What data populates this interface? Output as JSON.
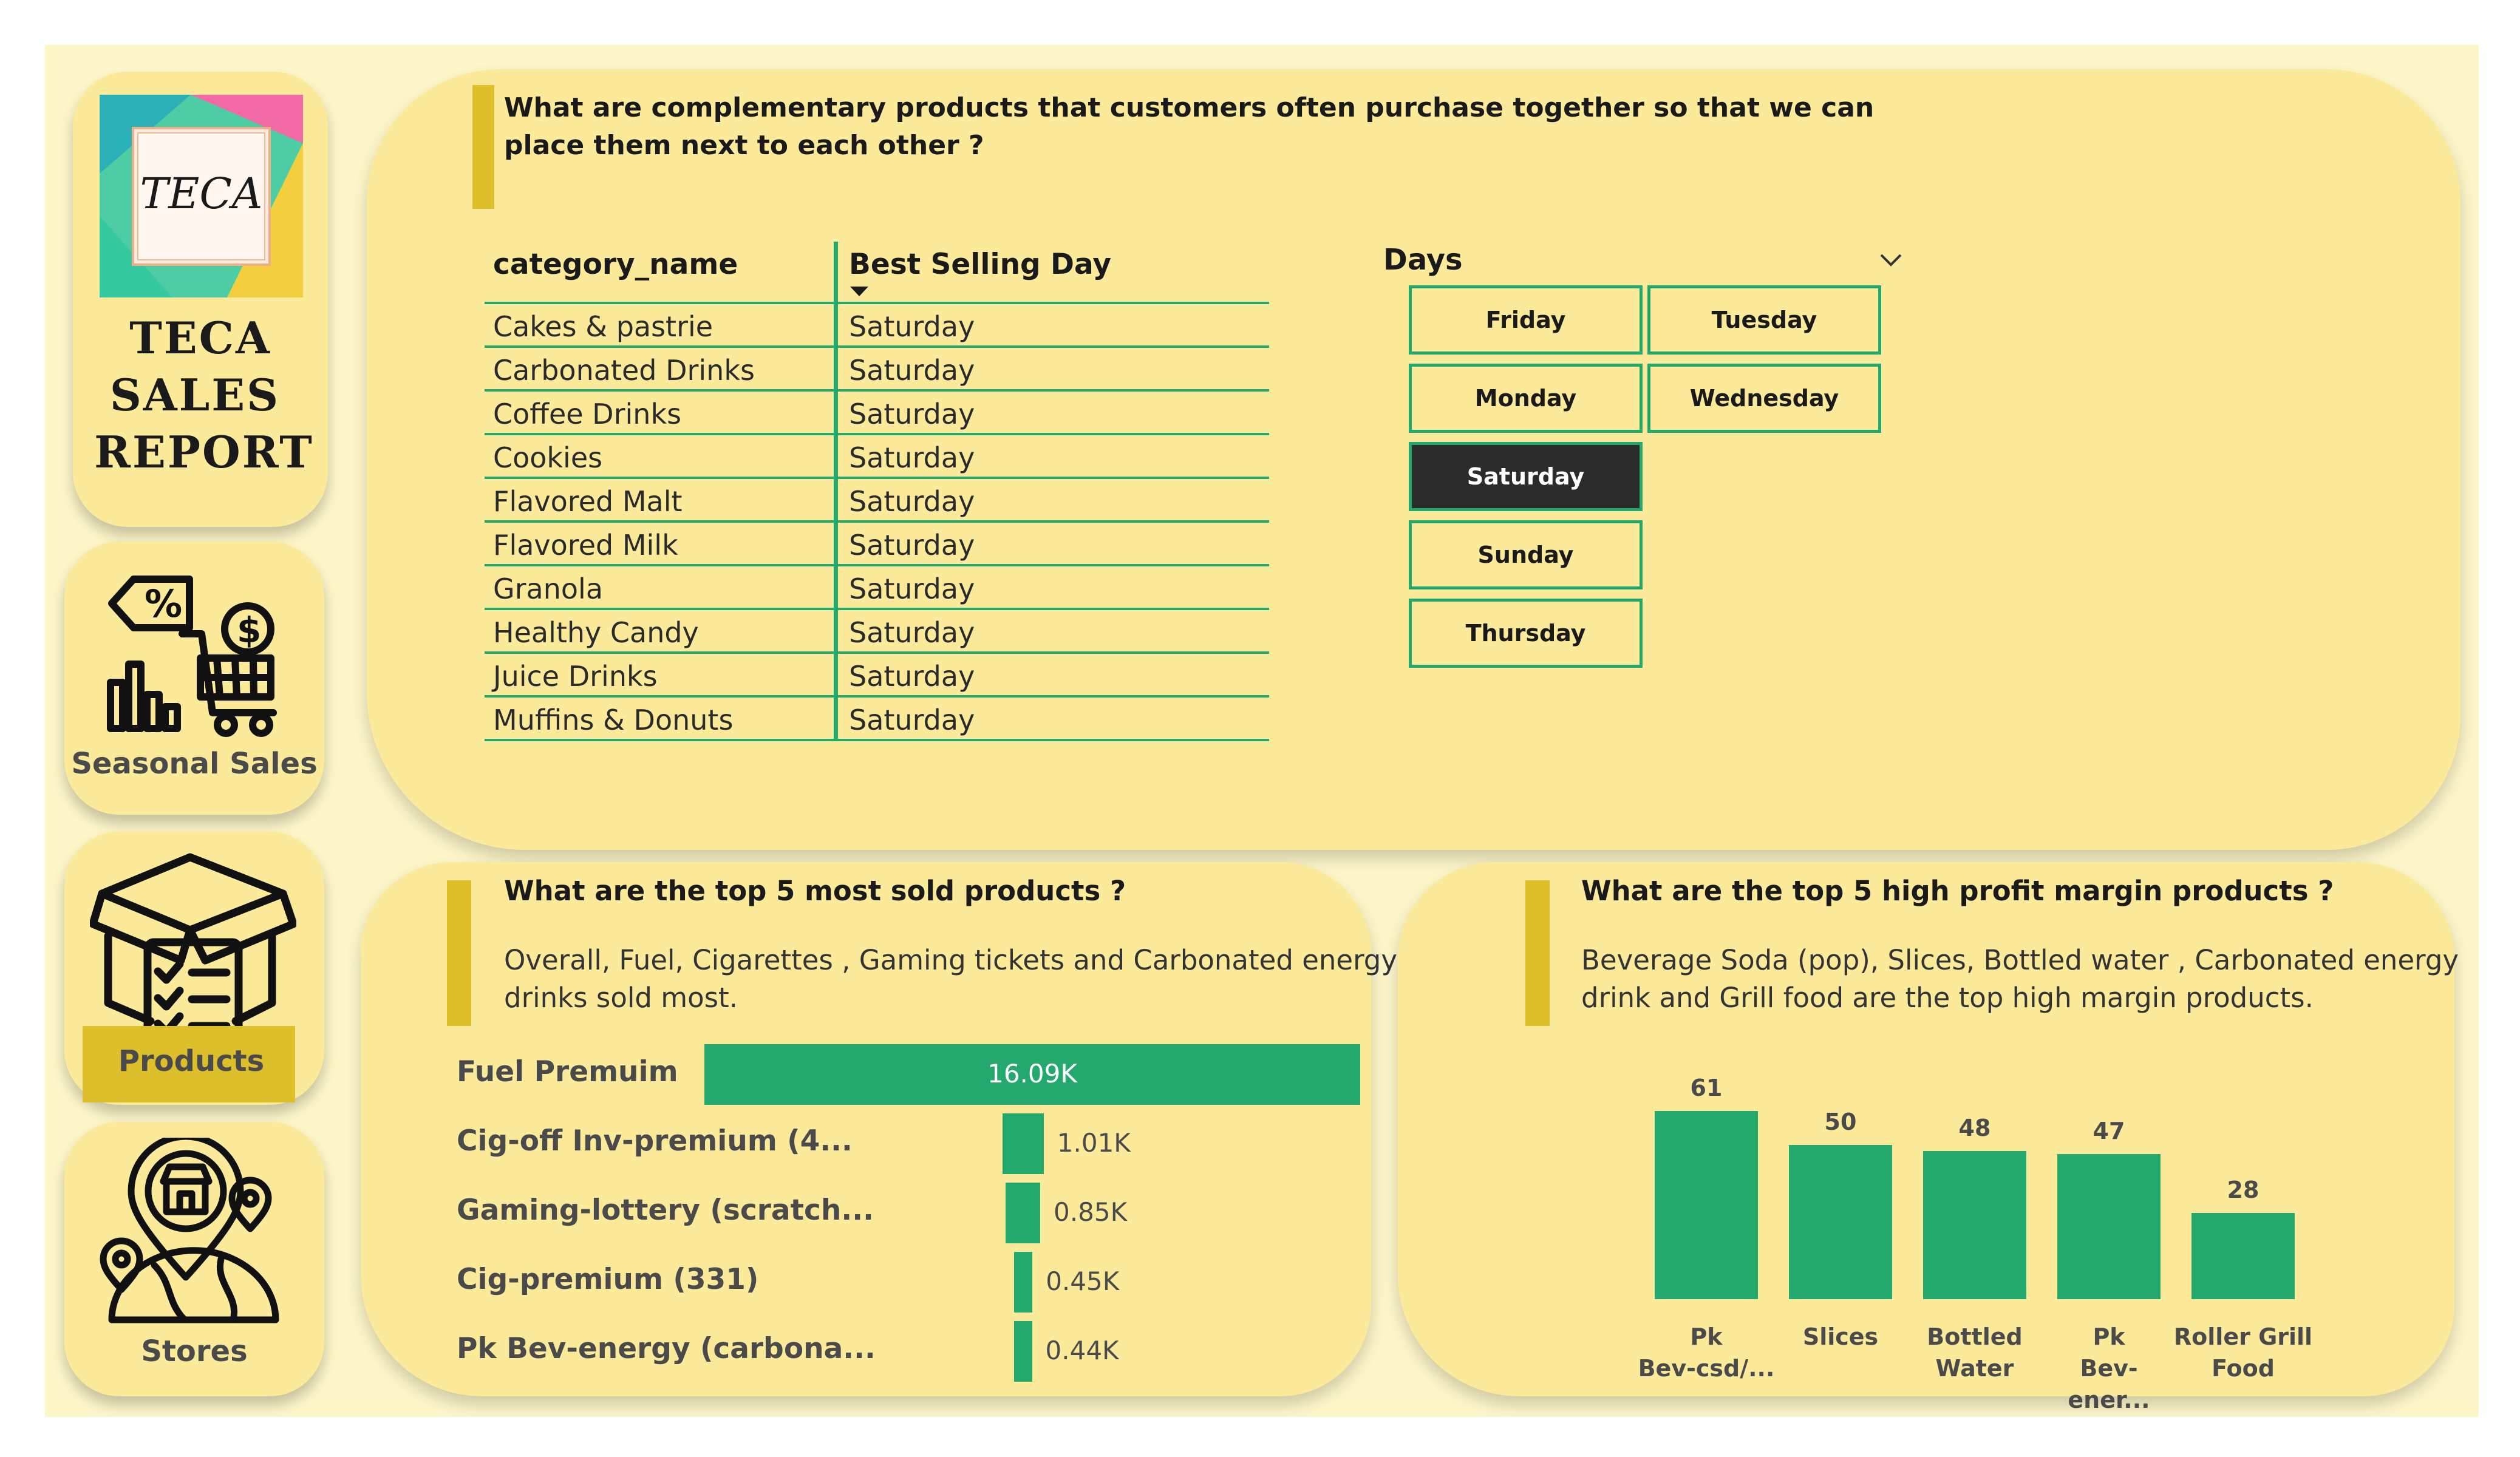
{
  "nav": {
    "report_title": [
      "TECA",
      "SALES",
      "REPORT"
    ],
    "logo_text": "TECA",
    "items": [
      {
        "label": "Seasonal Sales",
        "icon": "shopping-cart-discount-icon"
      },
      {
        "label": "Products",
        "icon": "box-checklist-icon",
        "active": true
      },
      {
        "label": "Stores",
        "icon": "store-location-icon"
      }
    ]
  },
  "top_panel": {
    "question_line1": "What  are complementary products that customers often purchase together so that we can",
    "question_line2": "place them next to each other ?",
    "table": {
      "headers": [
        "category_name",
        "Best Selling Day"
      ],
      "sort_indicator": "sort-descending-icon",
      "rows": [
        [
          "Cakes & pastrie",
          "Saturday"
        ],
        [
          "Carbonated Drinks",
          "Saturday"
        ],
        [
          "Coffee Drinks",
          "Saturday"
        ],
        [
          "Cookies",
          "Saturday"
        ],
        [
          "Flavored Malt",
          "Saturday"
        ],
        [
          "Flavored Milk",
          "Saturday"
        ],
        [
          "Granola",
          "Saturday"
        ],
        [
          "Healthy Candy",
          "Saturday"
        ],
        [
          "Juice Drinks",
          "Saturday"
        ],
        [
          "Muffins & Donuts",
          "Saturday"
        ]
      ]
    },
    "slicer": {
      "title": "Days",
      "options": [
        "Friday",
        "Tuesday",
        "Monday",
        "Wednesday",
        "Saturday",
        "Sunday",
        "Thursday"
      ],
      "selected": "Saturday"
    }
  },
  "most_sold": {
    "question": "What are the top 5 most sold products ?",
    "answer_line1": "Overall, Fuel, Cigarettes , Gaming tickets and Carbonated energy",
    "answer_line2": "drinks sold most."
  },
  "high_margin": {
    "question": "What are the top 5 high profit margin products ?",
    "answer_line1": "Beverage Soda (pop), Slices, Bottled water , Carbonated energy",
    "answer_line2": "drink and Grill food are the top high margin products."
  },
  "chart_data": [
    {
      "type": "bar",
      "orientation": "horizontal",
      "categories": [
        "Fuel Premuim",
        "Cig-off Inv-premium (4...",
        "Gaming-lottery (scratch...",
        "Cig-premium (331)",
        "Pk Bev-energy (carbona..."
      ],
      "values": [
        16090,
        1010,
        850,
        450,
        440
      ],
      "value_labels": [
        "16.09K",
        "1.01K",
        "0.85K",
        "0.45K",
        "0.44K"
      ],
      "color": "#23a86d"
    },
    {
      "type": "bar",
      "orientation": "vertical",
      "categories": [
        [
          "Pk",
          "Bev-csd/..."
        ],
        [
          "Slices"
        ],
        [
          "Bottled",
          "Water"
        ],
        [
          "Pk",
          "Bev-ener..."
        ],
        [
          "Roller Grill",
          "Food"
        ]
      ],
      "values": [
        61,
        50,
        48,
        47,
        28
      ],
      "value_labels": [
        "61",
        "50",
        "48",
        "47",
        "28"
      ],
      "color": "#23a86d"
    }
  ],
  "colors": {
    "page_background": "#fdf6c9",
    "card": "#fcea9b",
    "accent": "#dcbf2b",
    "bar": "#23a86d",
    "selected_day": "#2b2b2b"
  }
}
